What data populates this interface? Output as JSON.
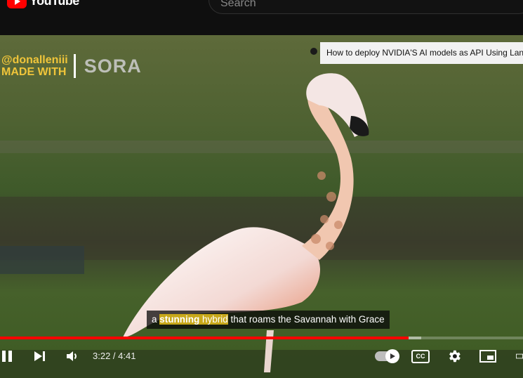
{
  "header": {
    "logo_text": "YouTube",
    "search_placeholder": "Search"
  },
  "video": {
    "watermark": {
      "handle": "@donalleniii",
      "made_with": "MADE WITH",
      "brand": "SORA"
    },
    "tooltip_title": "How to deploy NVIDIA'S AI models as API Using Lang",
    "caption": {
      "part1": "a ",
      "bold1": "stunning",
      "part2": " hybrid",
      "part3": " that roams the Savannah with Grace"
    }
  },
  "player": {
    "current_time": "3:22",
    "duration": "4:41",
    "time_display": "3:22 / 4:41",
    "progress_fraction": 0.781,
    "buffered_fraction": 0.805,
    "autoplay_on": true,
    "colors": {
      "progress": "#ff0000",
      "caption_highlight": "#c8a81a",
      "watermark": "#f0c53a"
    },
    "icons": [
      "pause-icon",
      "next-icon",
      "volume-icon",
      "autoplay-toggle",
      "cc-icon",
      "settings-gear-icon",
      "miniplayer-icon",
      "theater-icon"
    ]
  }
}
